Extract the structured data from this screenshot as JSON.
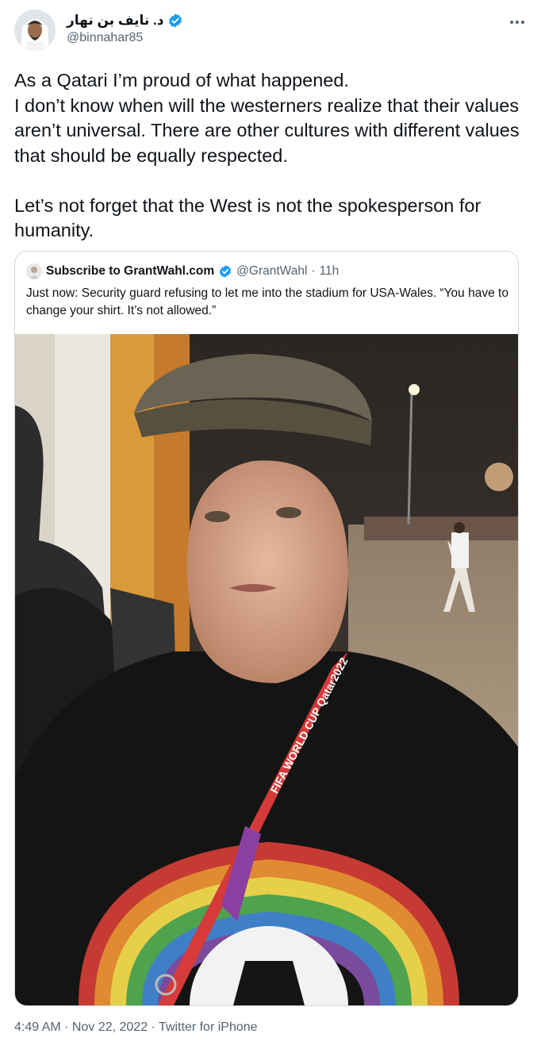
{
  "author": {
    "display_name": "د. نايف بن نهار",
    "handle": "@binnahar85",
    "verified_icon": "verified-badge-icon",
    "more_icon": "more-horizontal-icon"
  },
  "tweet": {
    "text": "As a Qatari I’m proud of what happened.\nI don’t know when will the westerners realize that their values aren’t universal. There are other cultures with different values that should be equally respected.\n\nLet’s not forget that the West is not the spokesperson for humanity."
  },
  "quoted": {
    "name": "Subscribe to GrantWahl.com",
    "handle": "@GrantWahl",
    "separator": "·",
    "time": "11h",
    "text": "Just now: Security guard refusing to let me into the stadium for USA-Wales. “You have to change your shirt. It’s not allowed.”",
    "photo_lanyard_text": "FIFA WORLD CUP Qatar2022"
  },
  "footer": {
    "time": "4:49 AM",
    "sep1": " · ",
    "date": "Nov 22, 2022",
    "sep2": " · ",
    "source": "Twitter for iPhone"
  },
  "colors": {
    "verified": "#1d9bf0",
    "secondary_text": "#536471",
    "border": "#cfd9de"
  }
}
